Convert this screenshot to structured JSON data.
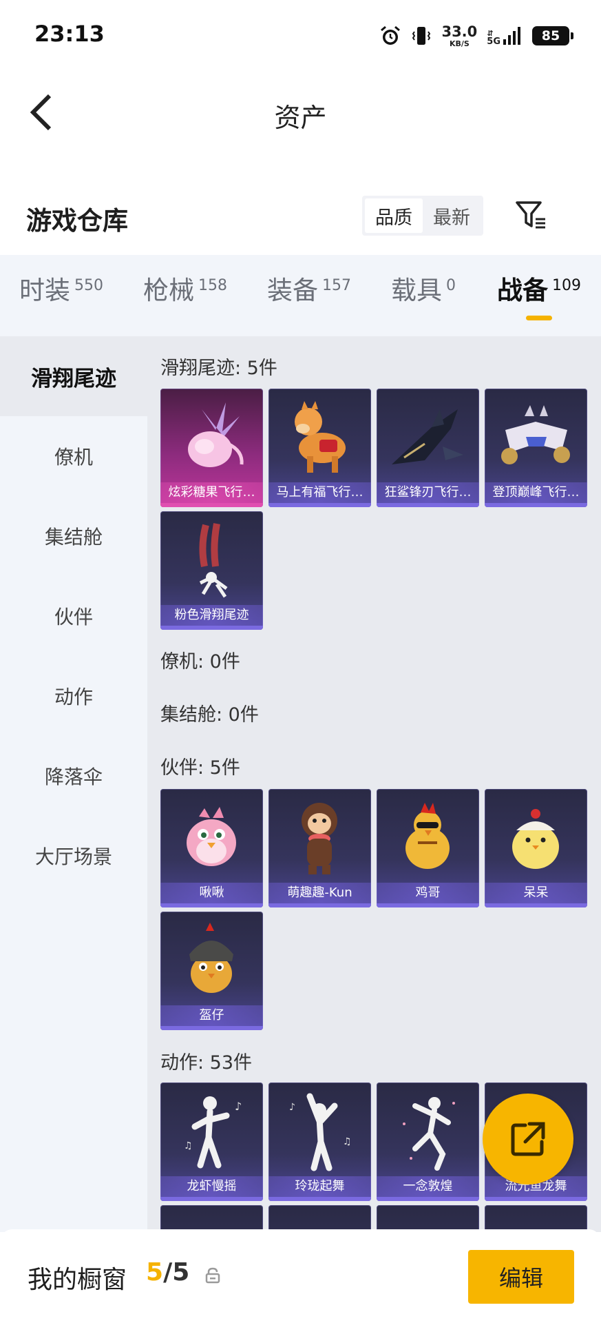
{
  "status_bar": {
    "time": "23:13",
    "net_speed": "33.0",
    "net_unit": "KB/S",
    "network": "5G",
    "battery": "85"
  },
  "nav": {
    "title": "资产",
    "back_icon": "chevron-left-icon"
  },
  "warehouse": {
    "title": "游戏仓库",
    "sort_options": [
      "品质",
      "最新"
    ],
    "sort_selected": "品质",
    "filter_icon": "filter-icon"
  },
  "category_tabs": [
    {
      "label": "时装",
      "count": "550"
    },
    {
      "label": "枪械",
      "count": "158"
    },
    {
      "label": "装备",
      "count": "157"
    },
    {
      "label": "载具",
      "count": "0"
    },
    {
      "label": "战备",
      "count": "109",
      "active": true
    }
  ],
  "side_menu": [
    {
      "label": "滑翔尾迹",
      "active": true
    },
    {
      "label": "僚机"
    },
    {
      "label": "集结舱"
    },
    {
      "label": "伙伴"
    },
    {
      "label": "动作"
    },
    {
      "label": "降落伞"
    },
    {
      "label": "大厅场景"
    }
  ],
  "sections": [
    {
      "title": "滑翔尾迹: 5件",
      "items": [
        "炫彩糖果飞行…",
        "马上有福飞行…",
        "狂鲨锋刃飞行…",
        "登顶巅峰飞行…",
        "粉色滑翔尾迹"
      ]
    },
    {
      "title": "僚机: 0件",
      "items": []
    },
    {
      "title": "集结舱: 0件",
      "items": []
    },
    {
      "title": "伙伴: 5件",
      "items": [
        "啾啾",
        "萌趣趣-Kun",
        "鸡哥",
        "呆呆",
        "盔仔"
      ]
    },
    {
      "title": "动作: 53件",
      "items": [
        "龙虾慢摇",
        "玲珑起舞",
        "一念敦煌",
        "流光鱼龙舞"
      ]
    }
  ],
  "bottom_bar": {
    "label": "我的橱窗",
    "current": "5",
    "separator": "/",
    "max": "5",
    "edit_label": "编辑"
  },
  "colors": {
    "accent": "#f7b500",
    "tab_bg": "#f2f5fa",
    "content_bg": "#e8eaef"
  }
}
